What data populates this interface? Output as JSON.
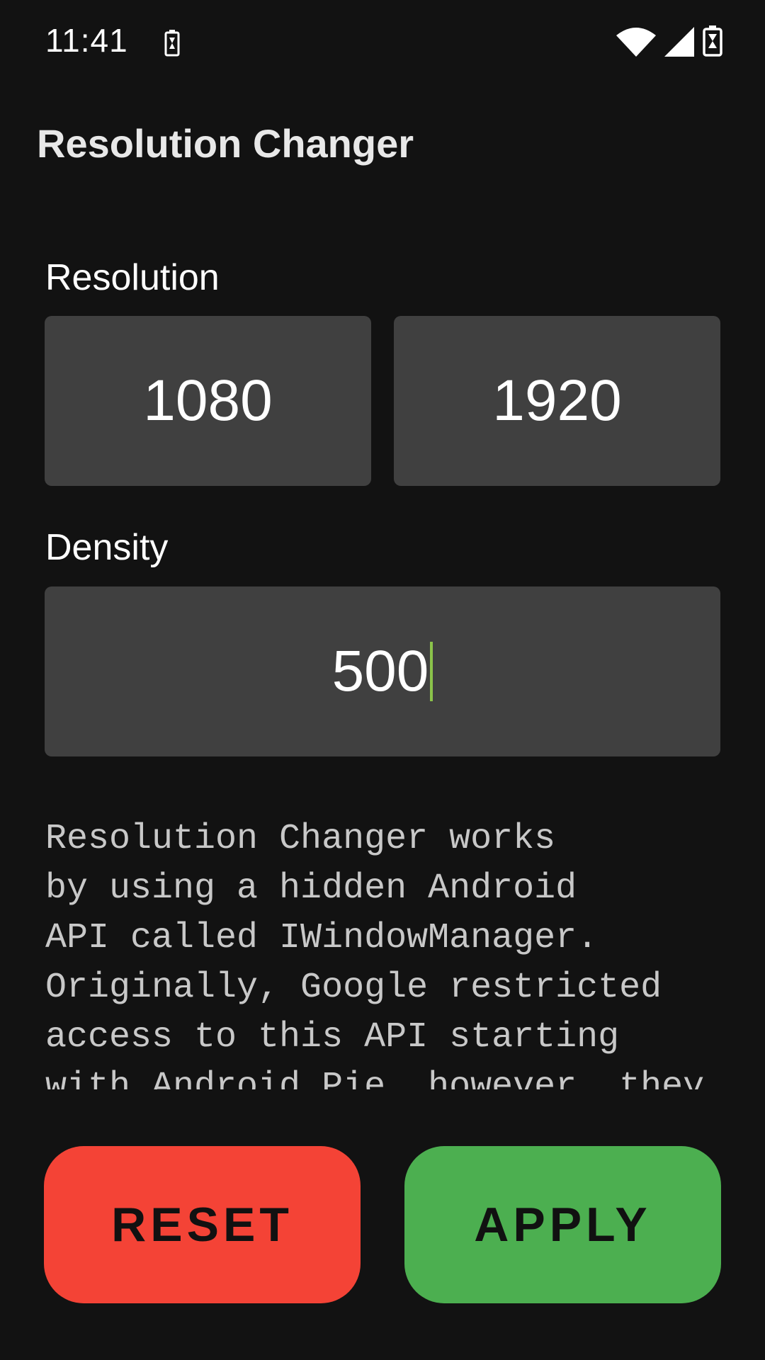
{
  "status_bar": {
    "time": "11:41",
    "icons": [
      "battery-saver-icon",
      "wifi-icon",
      "signal-icon",
      "battery-icon"
    ]
  },
  "app": {
    "title": "Resolution Changer"
  },
  "resolution": {
    "label": "Resolution",
    "width": "1080",
    "height": "1920"
  },
  "density": {
    "label": "Density",
    "value": "500"
  },
  "description": {
    "lines": [
      "Resolution Changer works",
      "by using a hidden Android",
      "API called IWindowManager.",
      "Originally, Google restricted",
      "access to this API starting",
      "with Android Pie, however, they"
    ]
  },
  "buttons": {
    "reset": "RESET",
    "apply": "APPLY"
  },
  "colors": {
    "background": "#121212",
    "field": "#404040",
    "reset": "#f44336",
    "apply": "#4caf50",
    "cursor": "#8bc34a"
  }
}
